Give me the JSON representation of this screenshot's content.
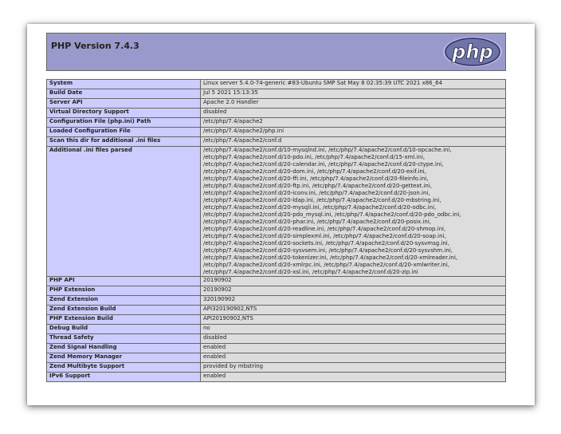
{
  "header": {
    "title": "PHP Version 7.4.3",
    "logo_text": "php"
  },
  "rows": [
    {
      "label": "System",
      "value": "Linux server 5.4.0-74-generic #83-Ubuntu SMP Sat May 8 02:35:39 UTC 2021 x86_64"
    },
    {
      "label": "Build Date",
      "value": "Jul 5 2021 15:13:35"
    },
    {
      "label": "Server API",
      "value": "Apache 2.0 Handler"
    },
    {
      "label": "Virtual Directory Support",
      "value": "disabled"
    },
    {
      "label": "Configuration File (php.ini) Path",
      "value": "/etc/php/7.4/apache2"
    },
    {
      "label": "Loaded Configuration File",
      "value": "/etc/php/7.4/apache2/php.ini"
    },
    {
      "label": "Scan this dir for additional .ini files",
      "value": "/etc/php/7.4/apache2/conf.d"
    },
    {
      "label": "Additional .ini files parsed",
      "value": "/etc/php/7.4/apache2/conf.d/10-mysqlnd.ini, /etc/php/7.4/apache2/conf.d/10-opcache.ini, /etc/php/7.4/apache2/conf.d/10-pdo.ini, /etc/php/7.4/apache2/conf.d/15-xml.ini, /etc/php/7.4/apache2/conf.d/20-calendar.ini, /etc/php/7.4/apache2/conf.d/20-ctype.ini, /etc/php/7.4/apache2/conf.d/20-dom.ini, /etc/php/7.4/apache2/conf.d/20-exif.ini, /etc/php/7.4/apache2/conf.d/20-ffi.ini, /etc/php/7.4/apache2/conf.d/20-fileinfo.ini, /etc/php/7.4/apache2/conf.d/20-ftp.ini, /etc/php/7.4/apache2/conf.d/20-gettext.ini, /etc/php/7.4/apache2/conf.d/20-iconv.ini, /etc/php/7.4/apache2/conf.d/20-json.ini, /etc/php/7.4/apache2/conf.d/20-ldap.ini, /etc/php/7.4/apache2/conf.d/20-mbstring.ini, /etc/php/7.4/apache2/conf.d/20-mysqli.ini, /etc/php/7.4/apache2/conf.d/20-odbc.ini, /etc/php/7.4/apache2/conf.d/20-pdo_mysql.ini, /etc/php/7.4/apache2/conf.d/20-pdo_odbc.ini, /etc/php/7.4/apache2/conf.d/20-phar.ini, /etc/php/7.4/apache2/conf.d/20-posix.ini, /etc/php/7.4/apache2/conf.d/20-readline.ini, /etc/php/7.4/apache2/conf.d/20-shmop.ini, /etc/php/7.4/apache2/conf.d/20-simplexml.ini, /etc/php/7.4/apache2/conf.d/20-soap.ini, /etc/php/7.4/apache2/conf.d/20-sockets.ini, /etc/php/7.4/apache2/conf.d/20-sysvmsg.ini, /etc/php/7.4/apache2/conf.d/20-sysvsem.ini, /etc/php/7.4/apache2/conf.d/20-sysvshm.ini, /etc/php/7.4/apache2/conf.d/20-tokenizer.ini, /etc/php/7.4/apache2/conf.d/20-xmlreader.ini, /etc/php/7.4/apache2/conf.d/20-xmlrpc.ini, /etc/php/7.4/apache2/conf.d/20-xmlwriter.ini, /etc/php/7.4/apache2/conf.d/20-xsl.ini, /etc/php/7.4/apache2/conf.d/20-zip.ini"
    },
    {
      "label": "PHP API",
      "value": "20190902"
    },
    {
      "label": "PHP Extension",
      "value": "20190902"
    },
    {
      "label": "Zend Extension",
      "value": "320190902"
    },
    {
      "label": "Zend Extension Build",
      "value": "API320190902,NTS"
    },
    {
      "label": "PHP Extension Build",
      "value": "API20190902,NTS"
    },
    {
      "label": "Debug Build",
      "value": "no"
    },
    {
      "label": "Thread Safety",
      "value": "disabled"
    },
    {
      "label": "Zend Signal Handling",
      "value": "enabled"
    },
    {
      "label": "Zend Memory Manager",
      "value": "enabled"
    },
    {
      "label": "Zend Multibyte Support",
      "value": "provided by mbstring"
    },
    {
      "label": "IPv6 Support",
      "value": "enabled"
    }
  ]
}
